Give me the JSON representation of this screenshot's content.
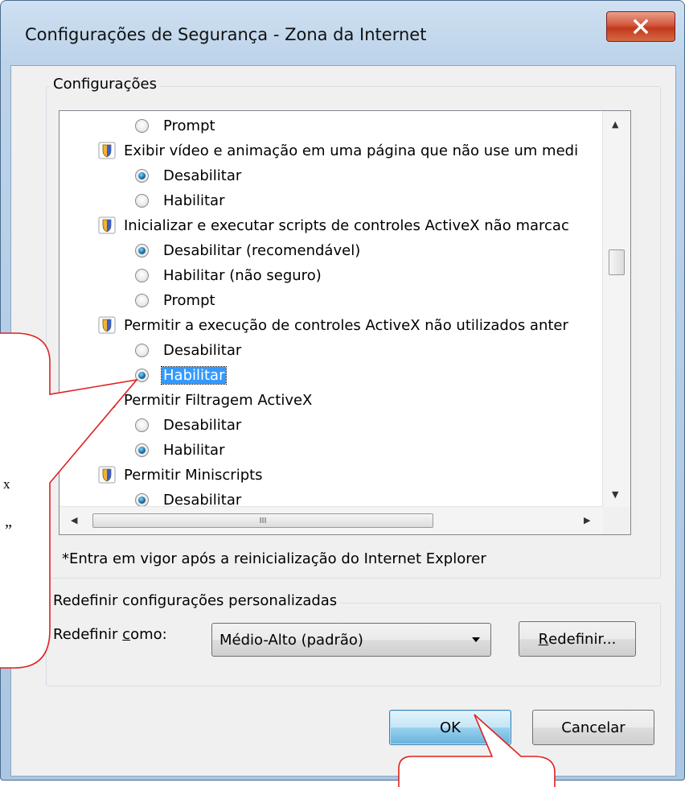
{
  "window": {
    "title": "Configurações de Segurança - Zona da Internet",
    "close_label": "X"
  },
  "settings_group": {
    "label": "Configurações",
    "rows": [
      {
        "kind": "option",
        "text": "Prompt",
        "checked": false
      },
      {
        "kind": "category",
        "text": "Exibir vídeo e animação em uma página que não use um medi"
      },
      {
        "kind": "option",
        "text": "Desabilitar",
        "checked": true
      },
      {
        "kind": "option",
        "text": "Habilitar",
        "checked": false
      },
      {
        "kind": "category",
        "text": "Inicializar e executar scripts de controles ActiveX não marcac"
      },
      {
        "kind": "option",
        "text": "Desabilitar (recomendável)",
        "checked": true
      },
      {
        "kind": "option",
        "text": "Habilitar (não seguro)",
        "checked": false
      },
      {
        "kind": "option",
        "text": "Prompt",
        "checked": false
      },
      {
        "kind": "category",
        "text": "Permitir a execução de controles ActiveX não utilizados anter"
      },
      {
        "kind": "option",
        "text": "Desabilitar",
        "checked": false
      },
      {
        "kind": "option",
        "text": "Habilitar",
        "checked": true,
        "selected": true
      },
      {
        "kind": "category",
        "text": "Permitir Filtragem ActiveX"
      },
      {
        "kind": "option",
        "text": "Desabilitar",
        "checked": false
      },
      {
        "kind": "option",
        "text": "Habilitar",
        "checked": true
      },
      {
        "kind": "category",
        "text": "Permitir Miniscripts"
      },
      {
        "kind": "option",
        "text": "Desabilitar",
        "checked": true
      }
    ],
    "hscroll_grip": "III",
    "restart_note": "*Entra em vigor após a reinicialização do Internet Explorer"
  },
  "reset_group": {
    "label": "Redefinir configurações personalizadas",
    "reset_as_prefix": "Redefinir ",
    "reset_as_accel": "c",
    "reset_as_suffix": "omo:",
    "level_value": "Médio-Alto (padrão)",
    "reset_button_accel": "R",
    "reset_button_rest": "edefinir..."
  },
  "footer": {
    "ok_label": "OK",
    "cancel_label": "Cancelar"
  },
  "callout": {
    "fragment_1": "x",
    "fragment_2": "”"
  }
}
